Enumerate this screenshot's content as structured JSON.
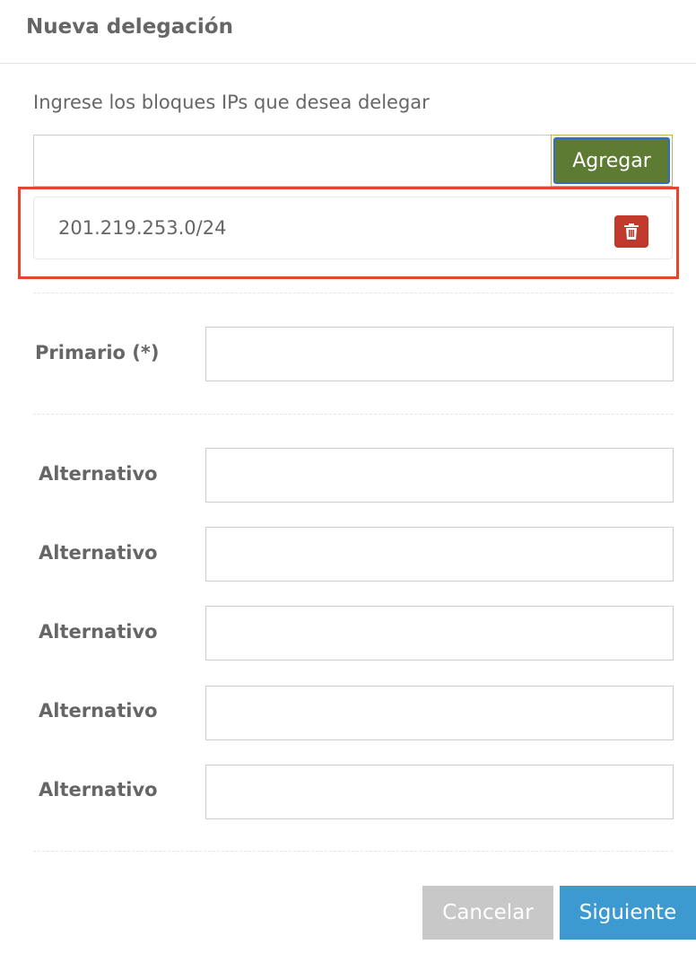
{
  "header": {
    "title": "Nueva delegación"
  },
  "ip_blocks": {
    "instructions": "Ingrese los bloques IPs que desea delegar",
    "input_value": "",
    "add_label": "Agregar",
    "items": [
      {
        "value": "201.219.253.0/24",
        "delete_icon": "trash-icon"
      }
    ]
  },
  "nameservers": {
    "primary": {
      "label": "Primario (*)",
      "value": ""
    },
    "alternates": [
      {
        "label": "Alternativo",
        "value": ""
      },
      {
        "label": "Alternativo",
        "value": ""
      },
      {
        "label": "Alternativo",
        "value": ""
      },
      {
        "label": "Alternativo",
        "value": ""
      },
      {
        "label": "Alternativo",
        "value": ""
      }
    ]
  },
  "footer": {
    "cancel_label": "Cancelar",
    "next_label": "Siguiente"
  },
  "colors": {
    "add_button": "#5d7b33",
    "delete_button": "#c0392b",
    "highlight": "#e2462c",
    "next_button": "#3d9ad1",
    "cancel_button": "#c8c8c8"
  }
}
